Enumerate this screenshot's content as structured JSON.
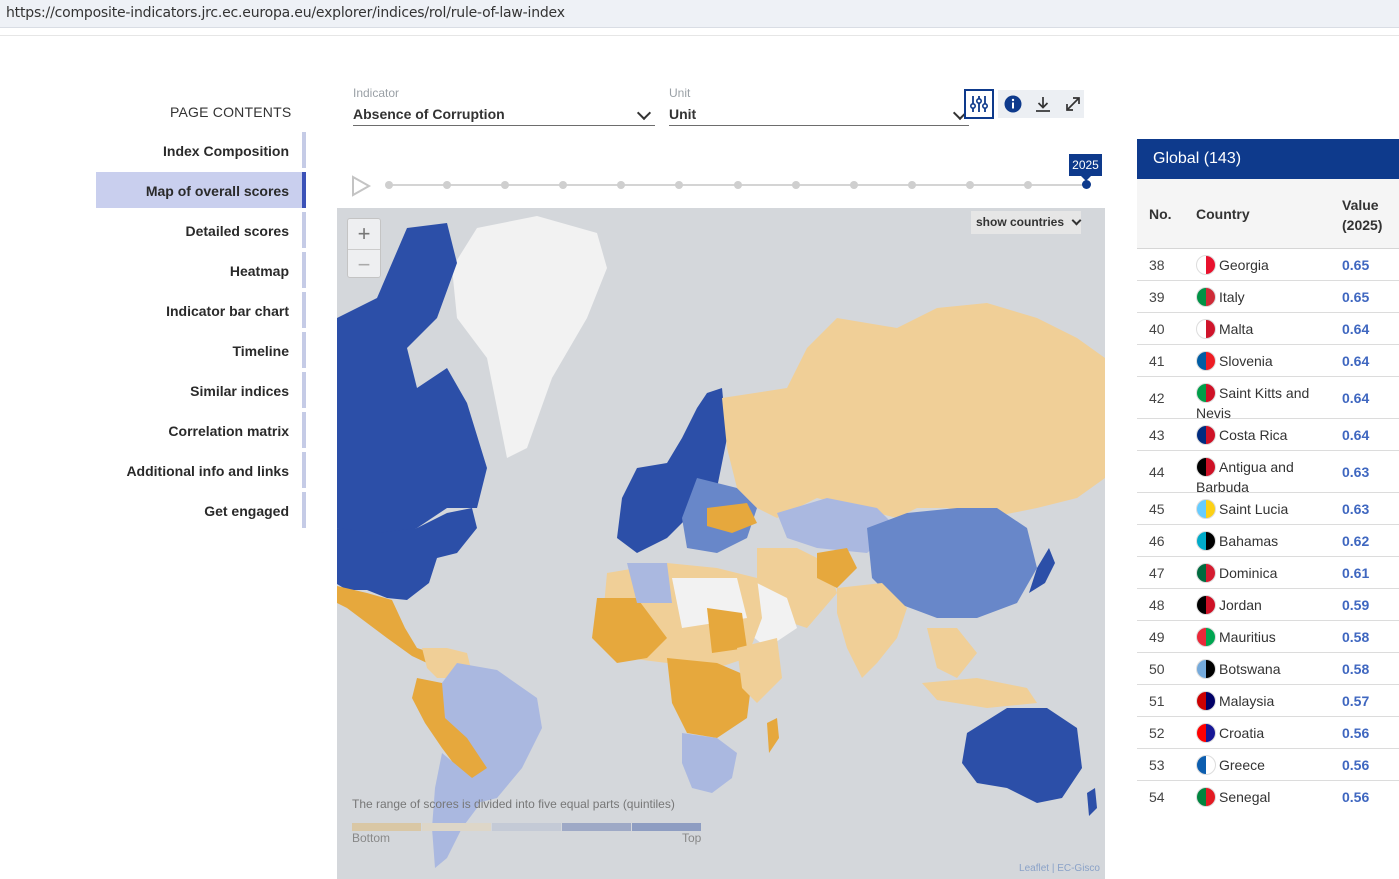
{
  "browser": {
    "url": "https://composite-indicators.jrc.ec.europa.eu/explorer/indices/rol/rule-of-law-index"
  },
  "sidebar": {
    "title": "PAGE CONTENTS",
    "items": [
      {
        "label": "Index Composition",
        "active": false
      },
      {
        "label": "Map of overall scores",
        "active": true
      },
      {
        "label": "Detailed scores",
        "active": false
      },
      {
        "label": "Heatmap",
        "active": false
      },
      {
        "label": "Indicator bar chart",
        "active": false
      },
      {
        "label": "Timeline",
        "active": false
      },
      {
        "label": "Similar indices",
        "active": false
      },
      {
        "label": "Correlation matrix",
        "active": false
      },
      {
        "label": "Additional info and links",
        "active": false
      },
      {
        "label": "Get engaged",
        "active": false
      }
    ]
  },
  "controls": {
    "indicator_caption": "Indicator",
    "indicator_value": "Absence of Corruption",
    "unit_caption": "Unit",
    "unit_value": "Unit",
    "icons": [
      "sliders-icon",
      "info-icon",
      "download-icon",
      "expand-icon"
    ]
  },
  "timeline": {
    "selected_year": "2025",
    "steps": 13,
    "selected_index": 12
  },
  "map": {
    "show_countries_label": "show countries",
    "zoom_in": "+",
    "zoom_out": "−",
    "legend_caption": "The range of scores is divided into five equal parts (quintiles)",
    "legend_bottom": "Bottom",
    "legend_top": "Top",
    "legend_colors": [
      "#d9c7a5",
      "#ddd6c8",
      "#c4cad6",
      "#9ea9c6",
      "#8e9dc2"
    ],
    "attribution": "Leaflet | EC-Gisco",
    "colors": {
      "top": "#2c4fa8",
      "high": "#6887c9",
      "mid": "#aab8e0",
      "low": "#f0cf97",
      "bottom": "#e6a83d",
      "nodata": "#f2f2f2",
      "water": "#d4d7db"
    }
  },
  "ranking": {
    "title": "Global (143)",
    "col_no": "No.",
    "col_country": "Country",
    "col_value": "Value (2025)",
    "rows": [
      {
        "no": "38",
        "country": "Georgia",
        "value": "0.65",
        "flag": [
          "#ffffff",
          "#e8112d"
        ]
      },
      {
        "no": "39",
        "country": "Italy",
        "value": "0.65",
        "flag": [
          "#009246",
          "#ce2b37"
        ]
      },
      {
        "no": "40",
        "country": "Malta",
        "value": "0.64",
        "flag": [
          "#ffffff",
          "#cf142b"
        ]
      },
      {
        "no": "41",
        "country": "Slovenia",
        "value": "0.64",
        "flag": [
          "#005da4",
          "#ed1c24"
        ]
      },
      {
        "no": "42",
        "country": "Saint Kitts and Nevis",
        "value": "0.64",
        "flag": [
          "#009e49",
          "#ce1126"
        ]
      },
      {
        "no": "43",
        "country": "Costa Rica",
        "value": "0.64",
        "flag": [
          "#002b7f",
          "#ce1126"
        ]
      },
      {
        "no": "44",
        "country": "Antigua and Barbuda",
        "value": "0.63",
        "flag": [
          "#000000",
          "#ce1126"
        ]
      },
      {
        "no": "45",
        "country": "Saint Lucia",
        "value": "0.63",
        "flag": [
          "#66ccff",
          "#fcd116"
        ]
      },
      {
        "no": "46",
        "country": "Bahamas",
        "value": "0.62",
        "flag": [
          "#00abc9",
          "#000000"
        ]
      },
      {
        "no": "47",
        "country": "Dominica",
        "value": "0.61",
        "flag": [
          "#006b3f",
          "#d41c30"
        ]
      },
      {
        "no": "48",
        "country": "Jordan",
        "value": "0.59",
        "flag": [
          "#000000",
          "#ce1126"
        ]
      },
      {
        "no": "49",
        "country": "Mauritius",
        "value": "0.58",
        "flag": [
          "#ea2839",
          "#00a551"
        ]
      },
      {
        "no": "50",
        "country": "Botswana",
        "value": "0.58",
        "flag": [
          "#75aadb",
          "#000000"
        ]
      },
      {
        "no": "51",
        "country": "Malaysia",
        "value": "0.57",
        "flag": [
          "#cc0001",
          "#010066"
        ]
      },
      {
        "no": "52",
        "country": "Croatia",
        "value": "0.56",
        "flag": [
          "#ff0000",
          "#171796"
        ]
      },
      {
        "no": "53",
        "country": "Greece",
        "value": "0.56",
        "flag": [
          "#0d5eaf",
          "#ffffff"
        ]
      },
      {
        "no": "54",
        "country": "Senegal",
        "value": "0.56",
        "flag": [
          "#00853f",
          "#e31b23"
        ]
      }
    ]
  }
}
